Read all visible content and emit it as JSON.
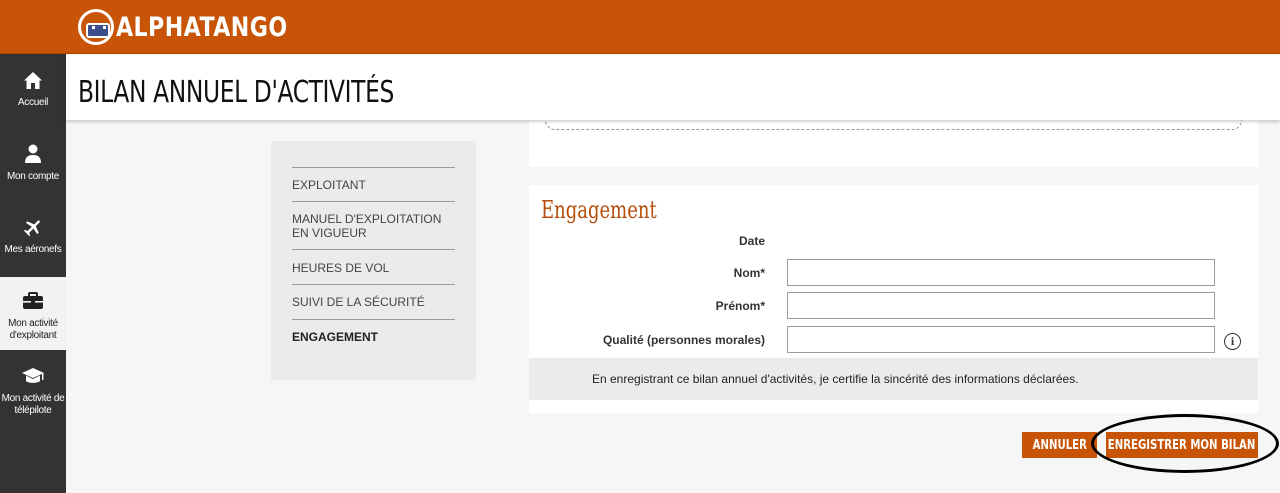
{
  "brand": {
    "name": "ALPHATANGO",
    "color": "#c75407"
  },
  "sidebar": {
    "items": [
      {
        "label": "Accueil",
        "icon": "home-icon",
        "active": false
      },
      {
        "label": "Mon compte",
        "icon": "user-icon",
        "active": false
      },
      {
        "label": "Mes aéronefs",
        "icon": "plane-icon",
        "active": false
      },
      {
        "label": "Mon activité d'exploitant",
        "icon": "briefcase-icon",
        "active": true
      },
      {
        "label": "Mon activité de télépilote",
        "icon": "graduation-cap-icon",
        "active": false
      }
    ]
  },
  "header": {
    "title": "BILAN ANNUEL D'ACTIVITÉS"
  },
  "steps": [
    {
      "label": "EXPLOITANT",
      "active": false
    },
    {
      "label": "MANUEL D'EXPLOITATION EN VIGUEUR",
      "active": false
    },
    {
      "label": "HEURES DE VOL",
      "active": false
    },
    {
      "label": "SUIVI DE LA SÉCURITÉ",
      "active": false
    },
    {
      "label": "ENGAGEMENT",
      "active": true
    }
  ],
  "engagement": {
    "title": "Engagement",
    "fields": {
      "date": {
        "label": "Date"
      },
      "nom": {
        "label": "Nom*",
        "value": ""
      },
      "prenom": {
        "label": "Prénom*",
        "value": ""
      },
      "qualite": {
        "label": "Qualité (personnes morales)",
        "value": ""
      }
    },
    "info_icon": "info-icon",
    "info_glyph": "i",
    "certification": "En enregistrant ce bilan annuel d'activités, je certifie la sincérité des informations déclarées."
  },
  "actions": {
    "cancel_label": "ANNULER",
    "save_label": "ENREGISTRER MON BILAN"
  },
  "colors": {
    "accent": "#c75407",
    "sidebar": "#333333",
    "title": "#b64d0a"
  }
}
